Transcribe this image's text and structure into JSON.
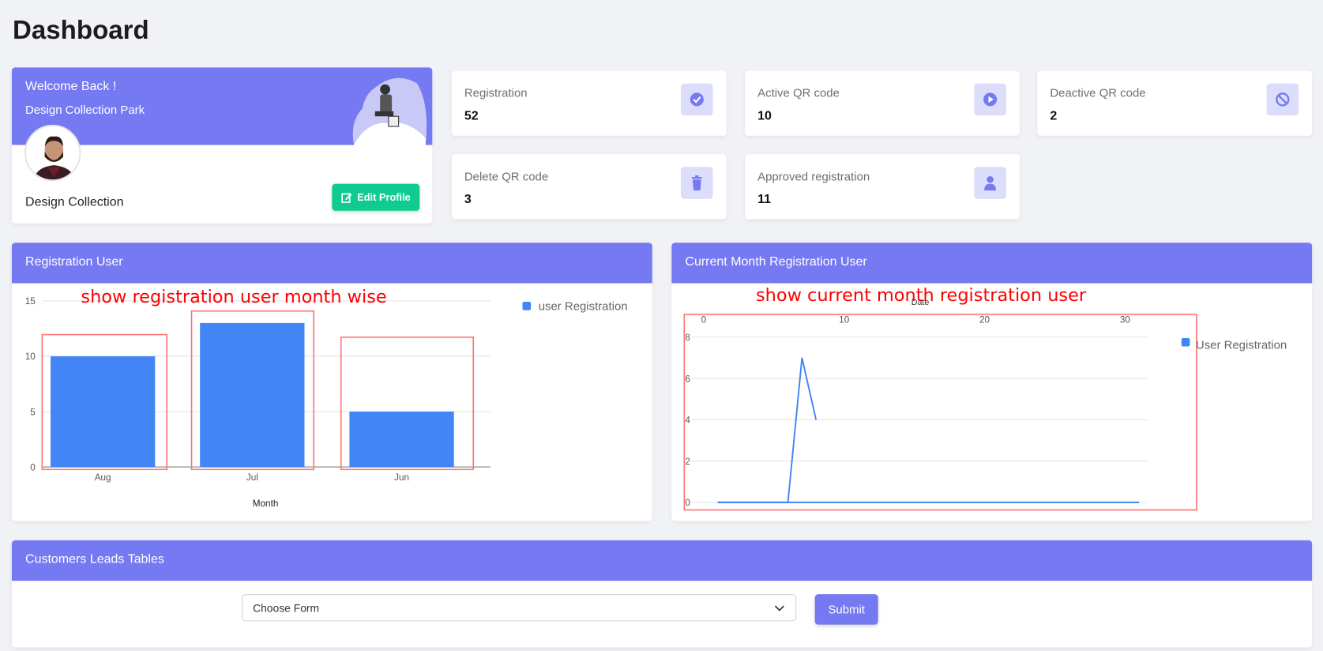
{
  "page_title": "Dashboard",
  "welcome": {
    "greeting": "Welcome Back !",
    "subtitle": "Design Collection Park",
    "user_name": "Design Collection",
    "edit_button": "Edit Profile"
  },
  "stats": [
    {
      "label": "Registration",
      "value": "52",
      "icon": "check-circle-icon"
    },
    {
      "label": "Active QR code",
      "value": "10",
      "icon": "play-circle-icon"
    },
    {
      "label": "Deactive QR code",
      "value": "2",
      "icon": "ban-icon"
    },
    {
      "label": "Delete QR code",
      "value": "3",
      "icon": "trash-icon"
    },
    {
      "label": "Approved registration",
      "value": "11",
      "icon": "user-icon"
    }
  ],
  "colors": {
    "accent": "#7579f2",
    "success": "#0fcb91",
    "series": "#4285f4",
    "annotation": "#ff0000",
    "icon_bg": "#dcdcfb"
  },
  "panels": {
    "registration_user": {
      "title": "Registration User",
      "annotation": "show registration user month wise"
    },
    "current_month": {
      "title": "Current Month Registration User",
      "annotation": "show current month registration user"
    },
    "leads": {
      "title": "Customers Leads Tables",
      "select_value": "Choose Form",
      "submit": "Submit"
    }
  },
  "chart_data": [
    {
      "type": "bar",
      "categories": [
        "Aug",
        "Jul",
        "Jun"
      ],
      "series": [
        {
          "name": "user Registration",
          "values": [
            10,
            13,
            5
          ]
        }
      ],
      "xlabel": "Month",
      "ylabel": "",
      "ylim": [
        0,
        15
      ],
      "yticks": [
        "0",
        "5",
        "10",
        "15"
      ],
      "grid": true,
      "legend": "right"
    },
    {
      "type": "line",
      "series": [
        {
          "name": "User Registration",
          "segments": [
            [
              [
                1,
                0
              ],
              [
                6,
                0
              ],
              [
                7,
                7
              ],
              [
                8,
                4
              ]
            ],
            [
              [
                1,
                0
              ],
              [
                31,
                0
              ]
            ]
          ]
        }
      ],
      "xlabel": "Date",
      "x_axis_position": "top",
      "xlim": [
        0,
        32
      ],
      "xticks": [
        "0",
        "10",
        "20",
        "30"
      ],
      "ylim": [
        0,
        8
      ],
      "yticks": [
        "0",
        "2",
        "4",
        "6",
        "8"
      ],
      "grid": true,
      "legend": "right"
    }
  ]
}
